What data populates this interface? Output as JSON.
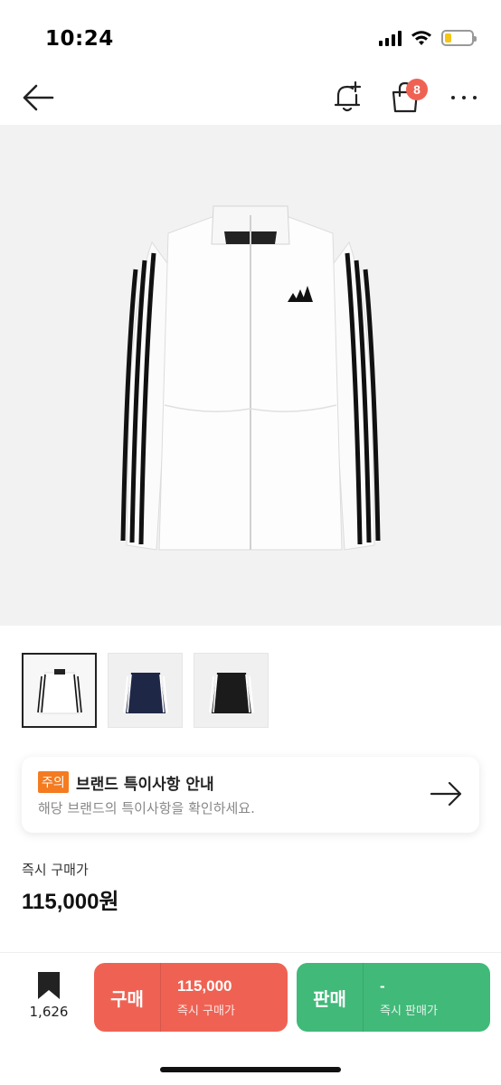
{
  "status_bar": {
    "time": "10:24",
    "battery_level": 0.25,
    "battery_color": "#f5c518"
  },
  "nav": {
    "back_icon": "arrow-left-icon",
    "alarm_icon": "bell-plus-icon",
    "cart_icon": "shopping-bag-icon",
    "cart_count": "8",
    "more_icon": "more-horizontal-icon"
  },
  "product": {
    "image_icon": "white-track-jacket-image",
    "thumbnails": [
      {
        "color": "#ffffff",
        "selected": true
      },
      {
        "color": "#1f2747",
        "selected": false
      },
      {
        "color": "#1b1b1b",
        "selected": false
      }
    ]
  },
  "notice": {
    "tag": "주의",
    "title": "브랜드 특이사항 안내",
    "description": "해당 브랜드의 특이사항을 확인하세요.",
    "tag_color": "#f47b20"
  },
  "price": {
    "label": "즉시 구매가",
    "value": "115,000원"
  },
  "bottom_bar": {
    "wish_count": "1,626",
    "buy": {
      "label": "구매",
      "price": "115,000",
      "sub": "즉시 구매가",
      "color": "#ef6253"
    },
    "sell": {
      "label": "판매",
      "price": "-",
      "sub": "즉시 판매가",
      "color": "#41b979"
    }
  }
}
